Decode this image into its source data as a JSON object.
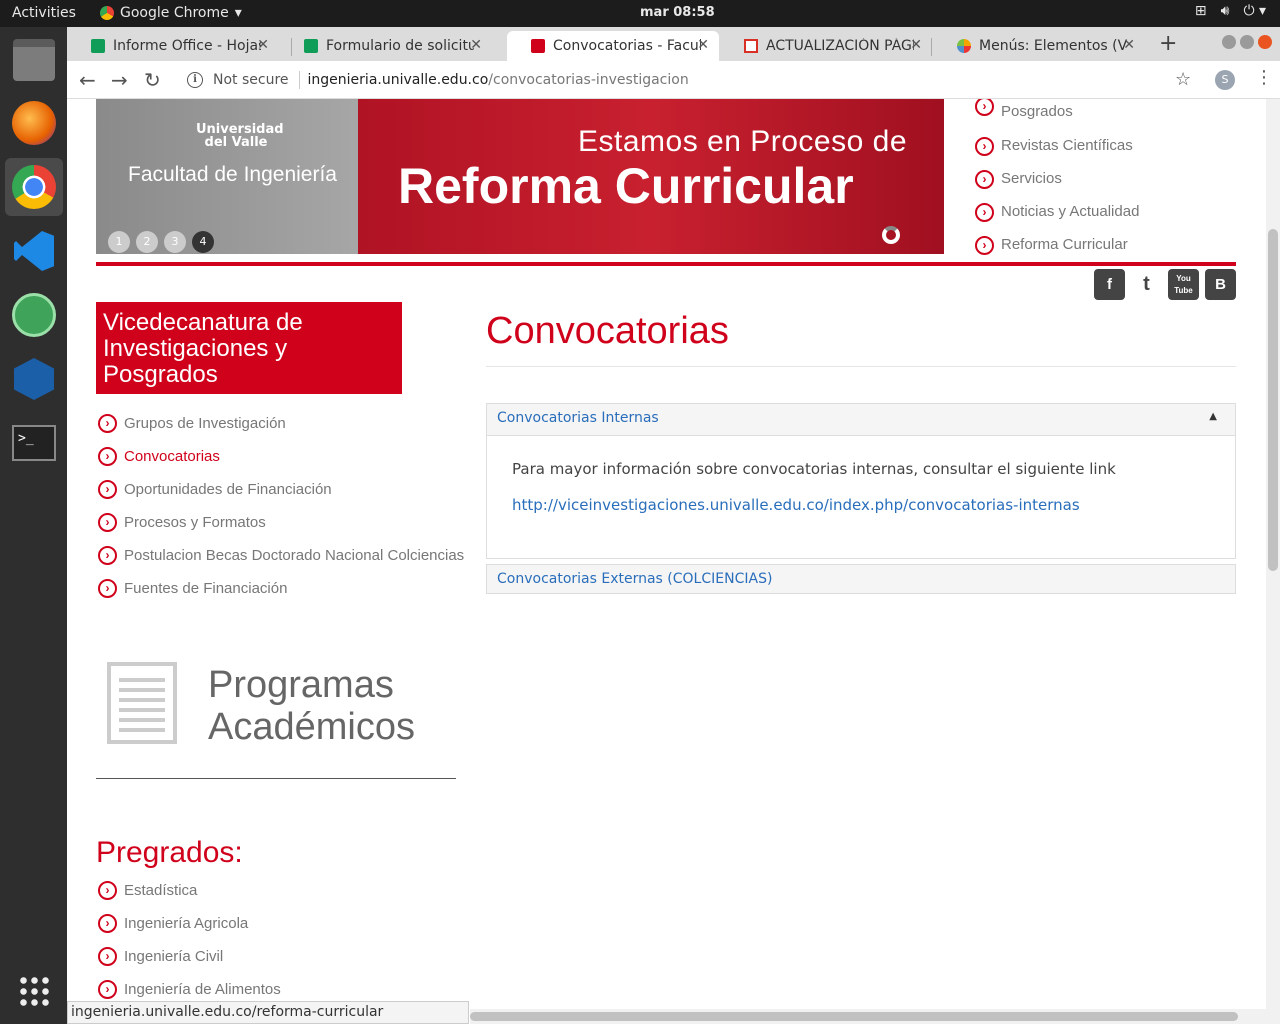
{
  "os": {
    "activities": "Activities",
    "app_name": "Google Chrome",
    "clock": "mar 08:58",
    "tray": [
      "network-icon",
      "volume-icon",
      "power-icon"
    ]
  },
  "dock": [
    {
      "name": "files-icon",
      "color": "#8a8a8a"
    },
    {
      "name": "firefox-icon",
      "color": "#e66000"
    },
    {
      "name": "chrome-icon",
      "color": "#4285f4"
    },
    {
      "name": "vscode-icon",
      "color": "#1e88e5"
    },
    {
      "name": "atom-icon",
      "color": "#3fa35a"
    },
    {
      "name": "virtualbox-icon",
      "color": "#1b5fa8"
    },
    {
      "name": "terminal-icon",
      "color": "#222"
    },
    {
      "name": "app-grid-icon",
      "color": "#ccc"
    }
  ],
  "tabs": [
    {
      "title": "Informe Office - Hojas",
      "favicon_color": "#0f9d58"
    },
    {
      "title": "Formulario de solicitud",
      "favicon_color": "#0f9d58"
    },
    {
      "title": "Convocatorias - Facultad",
      "favicon_color": "#d0021b"
    },
    {
      "title": "ACTUALIZACIÓN PÁGINA",
      "favicon_color": "#d93025"
    },
    {
      "title": "Menús: Elementos (Vi",
      "favicon_color": "#f4a300"
    }
  ],
  "toolbar": {
    "not_secure": "Not secure",
    "url_host": "ingenieria.univalle.edu.co",
    "url_path": "/convocatorias-investigacion",
    "profile_initial": "S"
  },
  "banner": {
    "university": "Universidad del Valle",
    "faculty": "Facultad de Ingeniería",
    "headline1": "Estamos en Proceso de",
    "headline2": "Reforma Curricular",
    "dots": [
      "1",
      "2",
      "3",
      "4"
    ],
    "active_dot": 3
  },
  "top_menu": [
    "Posgrados",
    "Revistas Científicas",
    "Servicios",
    "Noticias y Actualidad",
    "Reforma Curricular"
  ],
  "social": [
    "f",
    "t",
    "You Tube",
    "B"
  ],
  "sidebar": {
    "box_title": "Vicedecanatura de Investigaciones y Posgrados",
    "items": [
      "Grupos de Investigación",
      "Convocatorias",
      "Oportunidades de Financiación",
      "Procesos y Formatos",
      "Postulacion Becas Doctorado Nacional Colciencias",
      "Fuentes de Financiación"
    ],
    "current": "Convocatorias",
    "programs_title": "Programas Académicos",
    "pregrados_title": "Pregrados:",
    "pregrados": [
      "Estadística",
      "Ingeniería Agricola",
      "Ingeniería Civil",
      "Ingeniería de Alimentos"
    ]
  },
  "main": {
    "title": "Convocatorias",
    "accordion": [
      {
        "label": "Convocatorias Internas",
        "text": "Para mayor información sobre convocatorias internas, consultar el siguiente link",
        "link": "http://viceinvestigaciones.univalle.edu.co/index.php/convocatorias-internas",
        "expanded": true
      },
      {
        "label": "Convocatorias Externas (COLCIENCIAS)",
        "expanded": false
      }
    ]
  },
  "status_url": "ingenieria.univalle.edu.co/reforma-curricular",
  "colors": {
    "brand_red": "#d0021b",
    "link_blue": "#2a6ebb"
  }
}
